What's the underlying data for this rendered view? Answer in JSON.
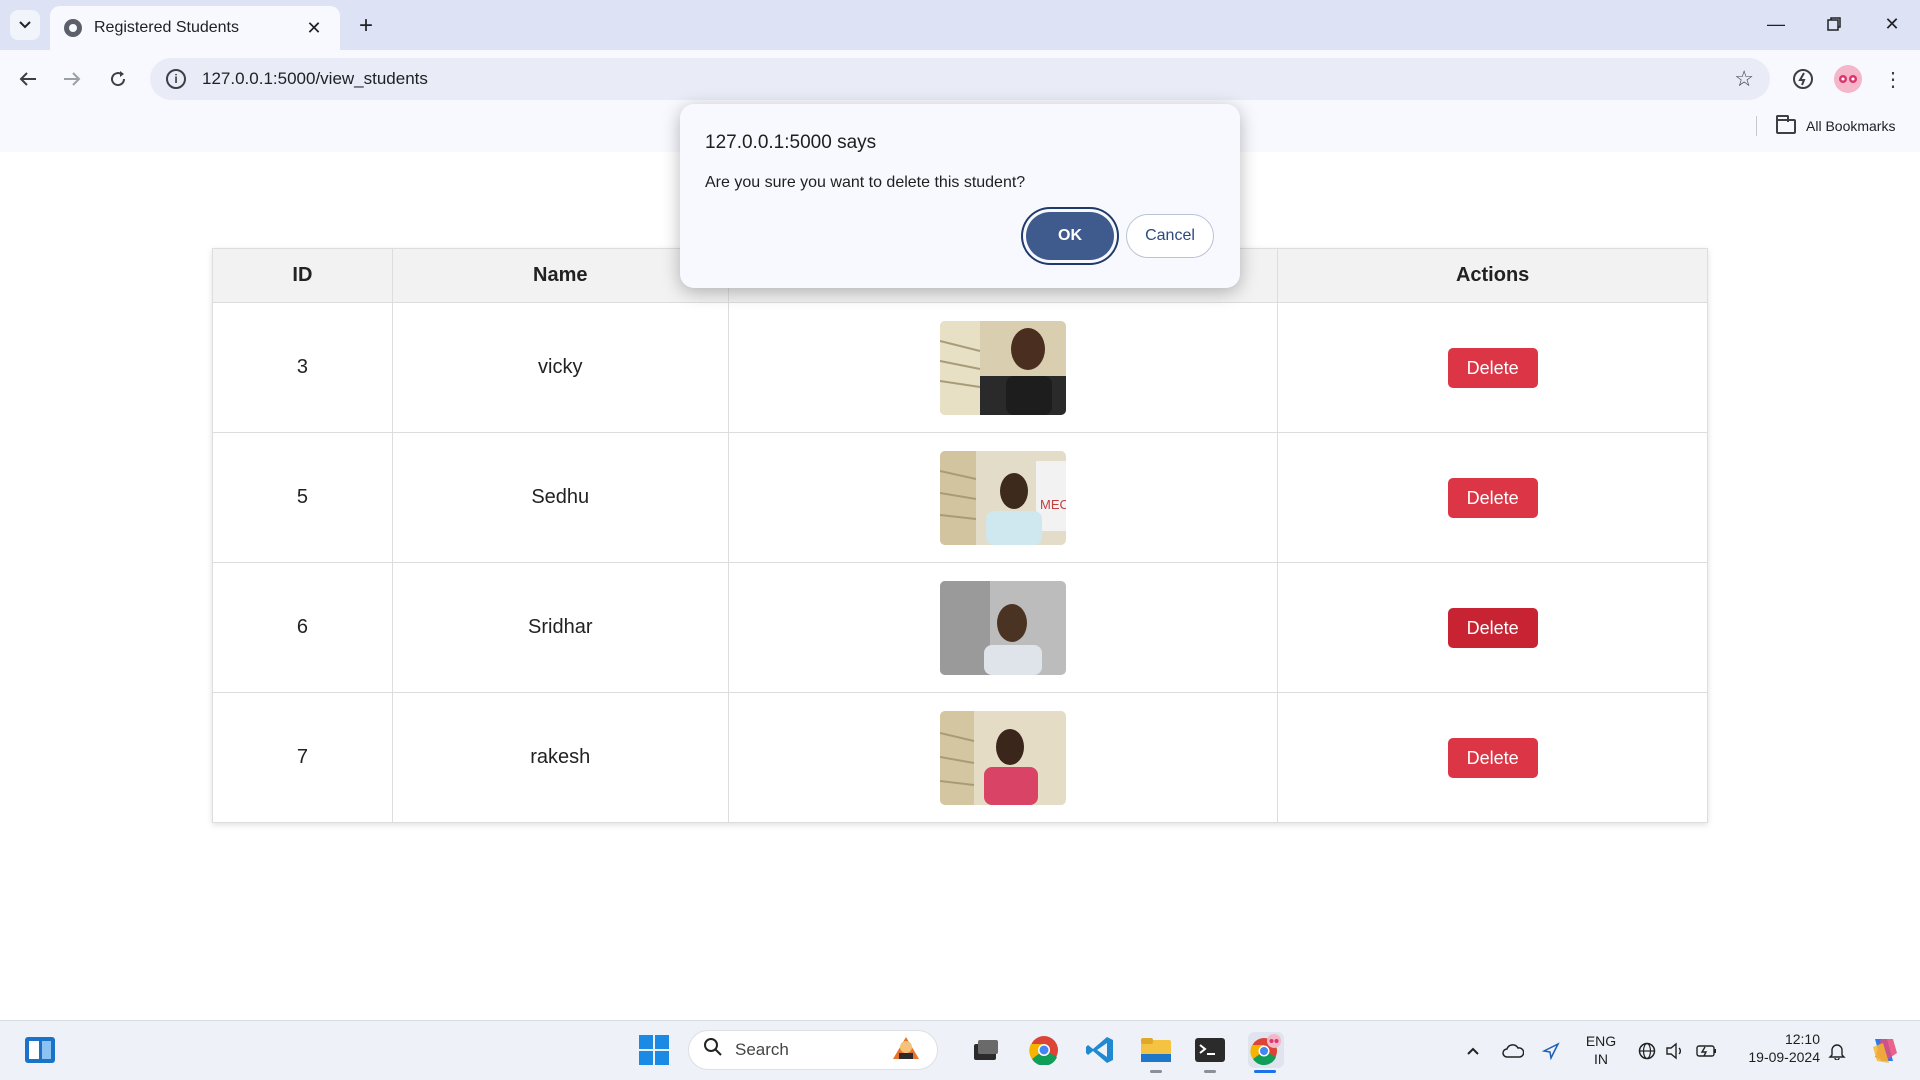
{
  "browser": {
    "tab_title": "Registered Students",
    "url": "127.0.0.1:5000/view_students",
    "bookmarks_label": "All Bookmarks"
  },
  "table": {
    "headers": {
      "id": "ID",
      "name": "Name",
      "actions": "Actions"
    },
    "rows": [
      {
        "id": "3",
        "name": "vicky",
        "action": "Delete"
      },
      {
        "id": "5",
        "name": "Sedhu",
        "action": "Delete"
      },
      {
        "id": "6",
        "name": "Sridhar",
        "action": "Delete"
      },
      {
        "id": "7",
        "name": "rakesh",
        "action": "Delete"
      }
    ]
  },
  "dialog": {
    "title": "127.0.0.1:5000 says",
    "message": "Are you sure you want to delete this student?",
    "ok_label": "OK",
    "cancel_label": "Cancel"
  },
  "taskbar": {
    "search_label": "Search",
    "lang_primary": "ENG",
    "lang_secondary": "IN",
    "time": "12:10",
    "date": "19-09-2024"
  },
  "colors": {
    "delete": "#dc3545",
    "ok_button": "#3f5b8e",
    "titlebar": "#dde3f5"
  }
}
